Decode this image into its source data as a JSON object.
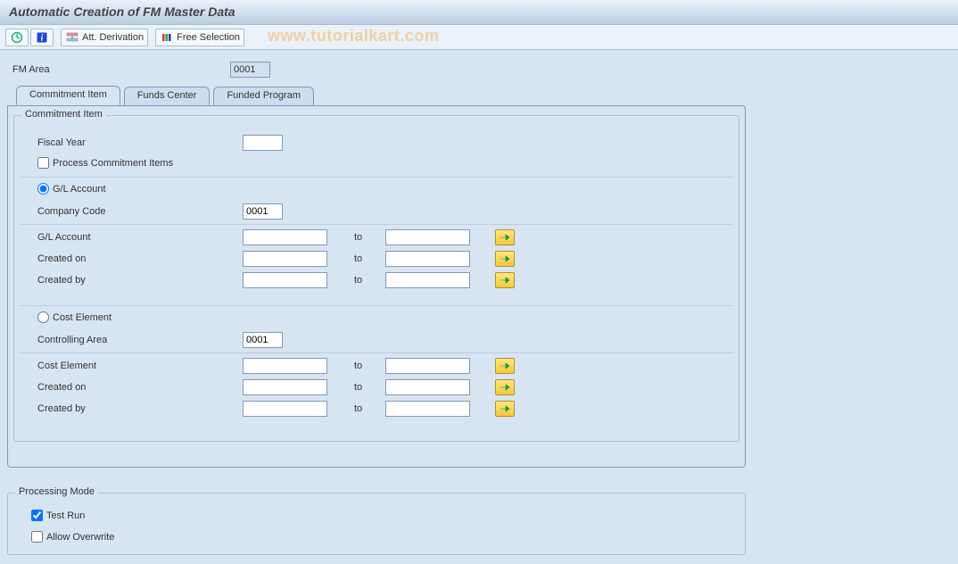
{
  "window": {
    "title": "Automatic Creation of FM Master Data"
  },
  "toolbar": {
    "att_derivation": "Att. Derivation",
    "free_selection": "Free Selection"
  },
  "watermark": "www.tutorialkart.com",
  "header": {
    "fm_area_label": "FM Area",
    "fm_area_value": "0001"
  },
  "tabs": [
    {
      "label": "Commitment Item",
      "active": true
    },
    {
      "label": "Funds Center",
      "active": false
    },
    {
      "label": "Funded Program",
      "active": false
    }
  ],
  "commitment_group": {
    "title": "Commitment Item",
    "fiscal_year_label": "Fiscal Year",
    "fiscal_year_value": "",
    "process_ci_label": "Process Commitment Items",
    "process_ci_checked": false,
    "gl_account_radio_label": "G/L Account",
    "gl_account_radio_checked": true,
    "company_code_label": "Company Code",
    "company_code_value": "0001",
    "gl_label": "G/L Account",
    "gl_from": "",
    "gl_to": "",
    "created_on_label": "Created on",
    "created_on_from": "",
    "created_on_to": "",
    "created_by_label": "Created by",
    "created_by_from": "",
    "created_by_to": "",
    "cost_element_radio_label": "Cost Element",
    "cost_element_radio_checked": false,
    "controlling_area_label": "Controlling Area",
    "controlling_area_value": "0001",
    "ce_label": "Cost Element",
    "ce_from": "",
    "ce_to": "",
    "ce_created_on_label": "Created on",
    "ce_created_on_from": "",
    "ce_created_on_to": "",
    "ce_created_by_label": "Created by",
    "ce_created_by_from": "",
    "ce_created_by_to": "",
    "to_label": "to"
  },
  "processing_mode": {
    "title": "Processing Mode",
    "test_run_label": "Test Run",
    "test_run_checked": true,
    "allow_overwrite_label": "Allow Overwrite",
    "allow_overwrite_checked": false
  }
}
